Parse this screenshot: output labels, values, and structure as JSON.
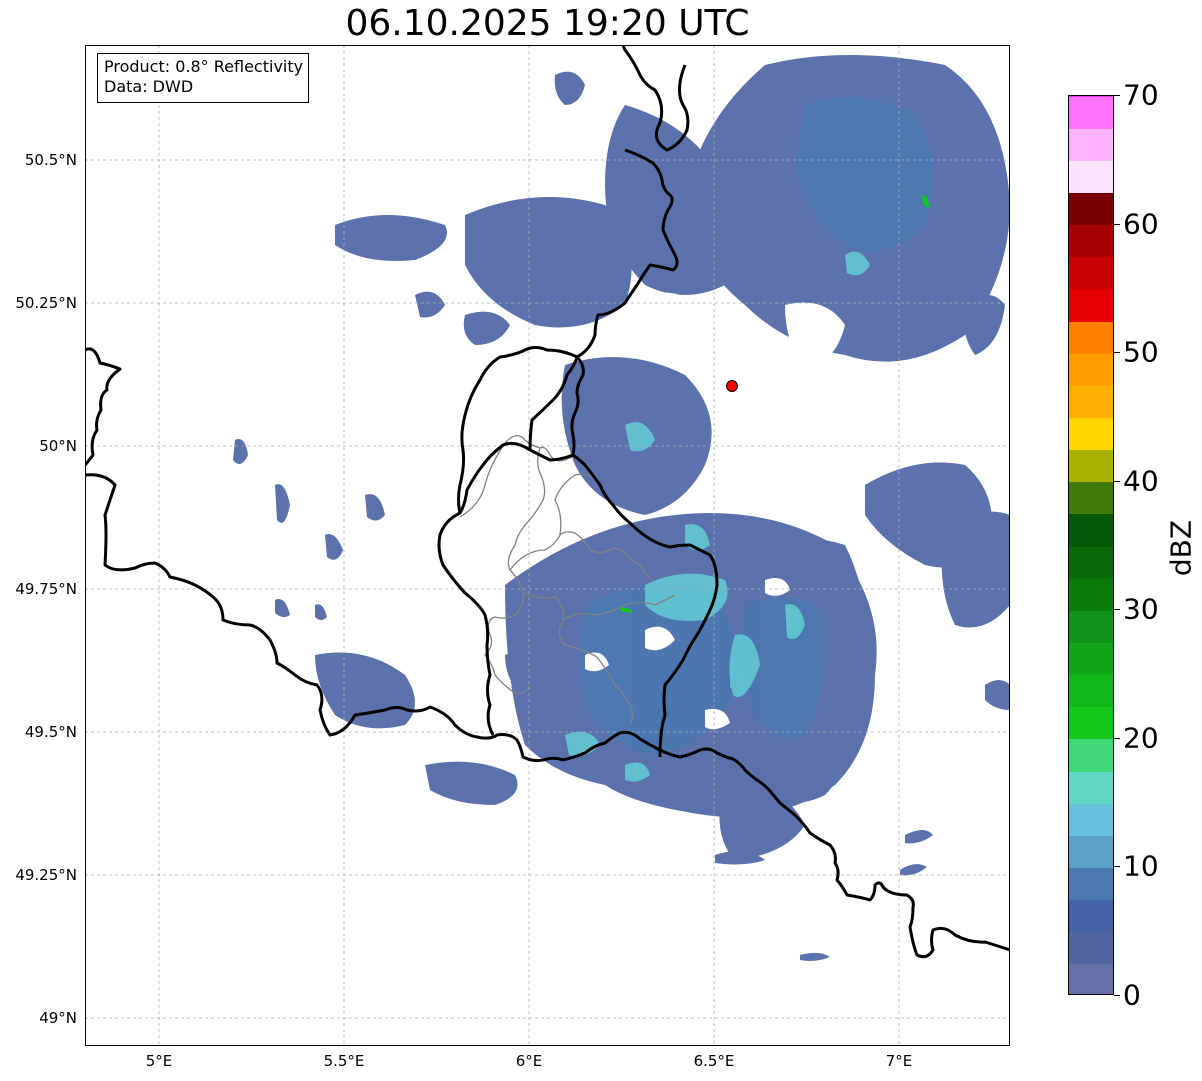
{
  "title": "06.10.2025 19:20 UTC",
  "info": {
    "product": "Product: 0.8° Reflectivity",
    "data": "Data: DWD"
  },
  "lat_labels": [
    "50.5°N",
    "50.25°N",
    "50°N",
    "49.75°N",
    "49.5°N",
    "49.25°N",
    "49°N"
  ],
  "lon_labels": [
    "5°E",
    "5.5°E",
    "6°E",
    "6.5°E",
    "7°E"
  ],
  "colorbar": {
    "label": "dBZ",
    "ticks": [
      "0",
      "10",
      "20",
      "30",
      "40",
      "50",
      "60",
      "70"
    ],
    "min": 0,
    "max": 70,
    "step": 2.5,
    "colors": [
      "#6472a8",
      "#51659e",
      "#4462a6",
      "#4a78b0",
      "#5ca0c8",
      "#65c0dc",
      "#60d6c4",
      "#3fd675",
      "#14c81a",
      "#13b619",
      "#11a617",
      "#10931a",
      "#0b7b0c",
      "#0b6a0b",
      "#065808",
      "#417a08",
      "#a9b101",
      "#ffd700",
      "#ffb000",
      "#ff9d00",
      "#ff7f00",
      "#e40000",
      "#c80000",
      "#a60000",
      "#7a0000",
      "#fce3ff",
      "#feb2ff",
      "#ff73ff",
      "#ea38ec"
    ]
  },
  "map": {
    "extent": {
      "lon_min": 4.8,
      "lon_max": 7.3,
      "lat_min": 48.95,
      "lat_max": 50.7
    },
    "radar_site": {
      "lon": 6.548,
      "lat": 50.11,
      "color": "#ff0000"
    },
    "colors": {
      "border": "#000000",
      "region_border": "#808080",
      "grid": "#b0b0b0",
      "echo_weak": "#4e66a6",
      "echo_mid": "#4a78b0",
      "echo_strong": "#62c8d2",
      "echo_core": "#14c81a"
    }
  }
}
